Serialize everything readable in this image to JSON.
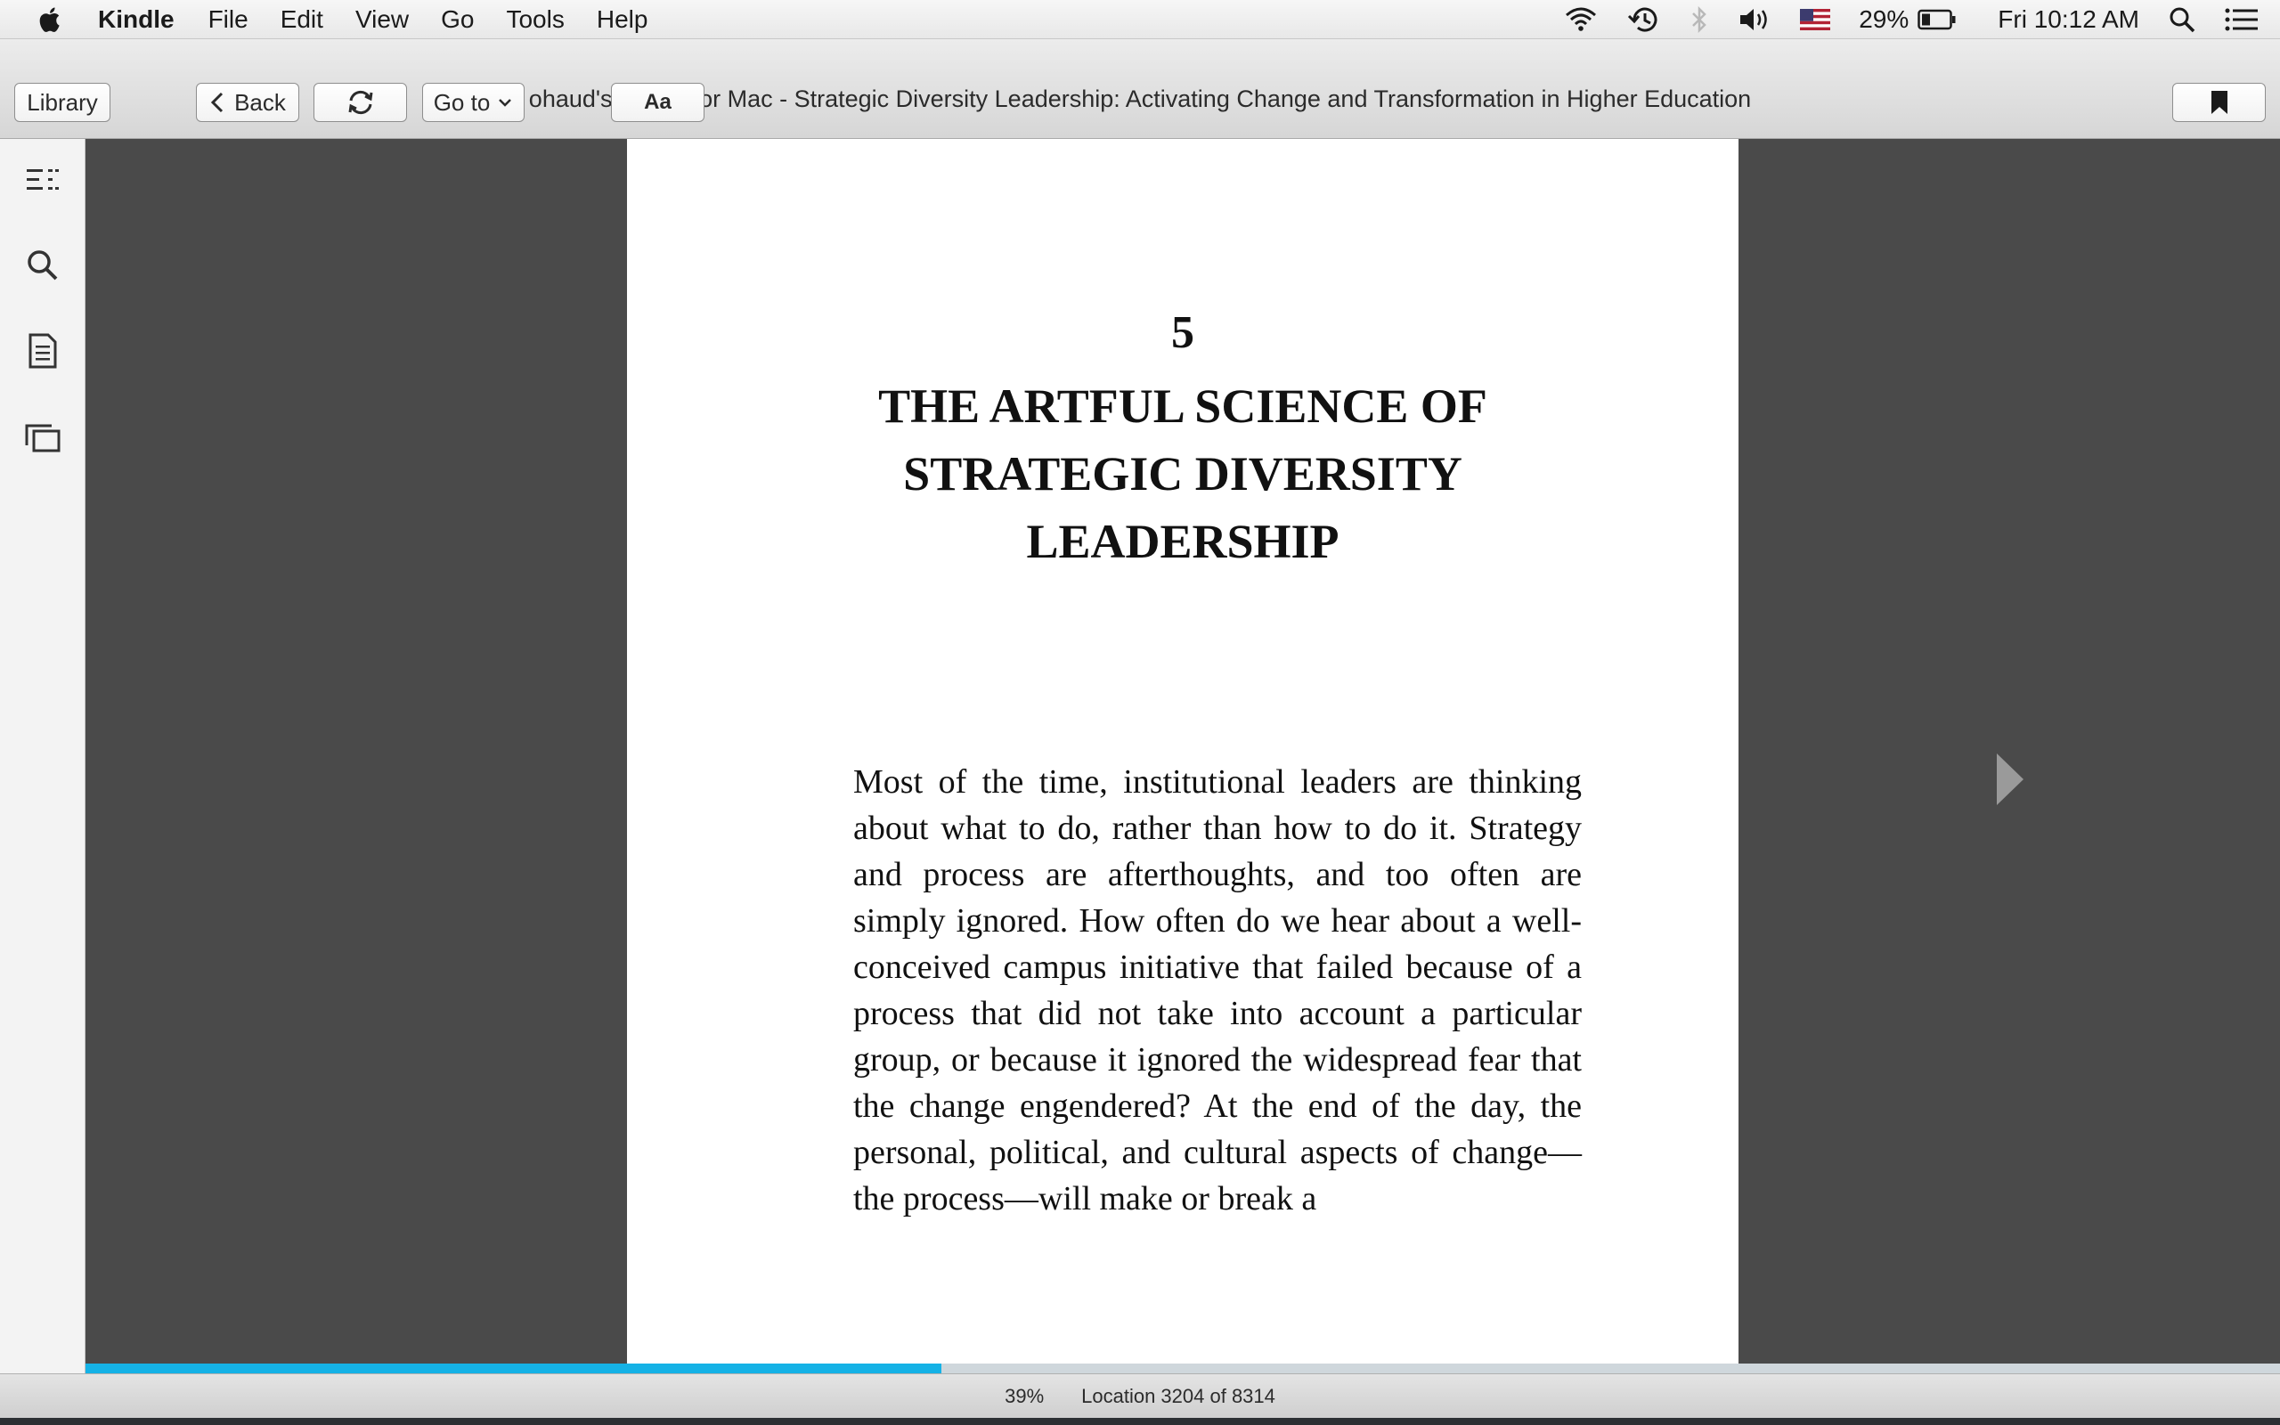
{
  "menubar": {
    "app_name": "Kindle",
    "items": [
      "File",
      "Edit",
      "View",
      "Go",
      "Tools",
      "Help"
    ],
    "battery": "29%",
    "clock": "Fri 10:12 AM"
  },
  "window": {
    "title": "ohaud's Kindle for Mac - Strategic Diversity Leadership: Activating Change and Transformation in Higher Education"
  },
  "toolbar": {
    "library_label": "Library",
    "back_label": "Back",
    "goto_label": "Go to",
    "font_label": "Aa"
  },
  "page": {
    "chapter_number": "5",
    "chapter_title": "THE ARTFUL SCIENCE OF STRATEGIC DIVERSITY LEADERSHIP",
    "body": "Most of the time, institutional leaders are thinking about what to do, rather than how to do it. Strategy and process are afterthoughts, and too often are simply ignored. How often do we hear about a well-conceived campus initiative that failed because of a process that did not take into account a particular group, or because it ignored the widespread fear that the change engendered? At the end of the day, the personal, political, and cultural aspects of change—the process—will make or break a"
  },
  "progress": {
    "percent_label": "39%",
    "fraction": 0.39,
    "location_label": "Location 3204 of 8314"
  },
  "colors": {
    "progress_fill": "#15b2e6",
    "reader_bg": "#4a4a4a"
  },
  "icons": {
    "sidebar": [
      "toc-icon",
      "search-icon",
      "notes-icon",
      "flashcards-icon"
    ]
  }
}
